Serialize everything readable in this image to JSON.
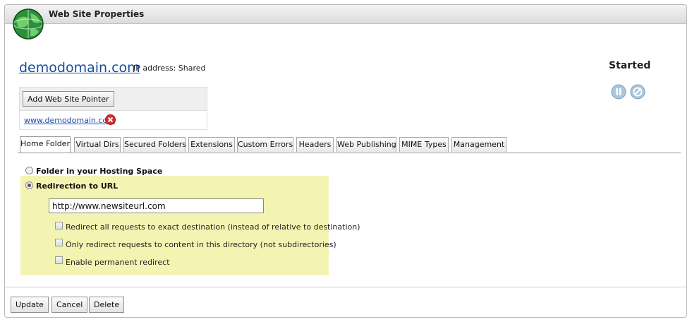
{
  "window": {
    "title": "Web Site Properties"
  },
  "site": {
    "domain": "demodomain.com",
    "ip_label": "IP address: Shared",
    "status": "Started"
  },
  "pointers": {
    "add_button": "Add Web Site Pointer",
    "items": [
      "www.demodomain.com"
    ]
  },
  "tabs": [
    "Home Folder",
    "Virtual Dirs",
    "Secured Folders",
    "Extensions",
    "Custom Errors",
    "Headers",
    "Web Publishing",
    "MIME Types",
    "Management"
  ],
  "active_tab": "Home Folder",
  "home_folder": {
    "option_folder": "Folder in your Hosting Space",
    "option_redirect": "Redirection to URL",
    "selected_option": "Redirection to URL",
    "redirect_url": "http://www.newsiteurl.com",
    "checkboxes": [
      {
        "label": "Redirect all requests to exact destination (instead of relative to destination)",
        "checked": false
      },
      {
        "label": "Only redirect requests to content in this directory (not subdirectories)",
        "checked": false
      },
      {
        "label": "Enable permanent redirect",
        "checked": false
      }
    ]
  },
  "footer": {
    "update": "Update",
    "cancel": "Cancel",
    "delete": "Delete"
  },
  "icons": {
    "globe": "globe-icon",
    "pause": "pause-icon",
    "stop": "stop-icon",
    "delete": "delete-icon"
  },
  "colors": {
    "link": "#1a4c9e",
    "highlight": "#f4f4b2"
  }
}
